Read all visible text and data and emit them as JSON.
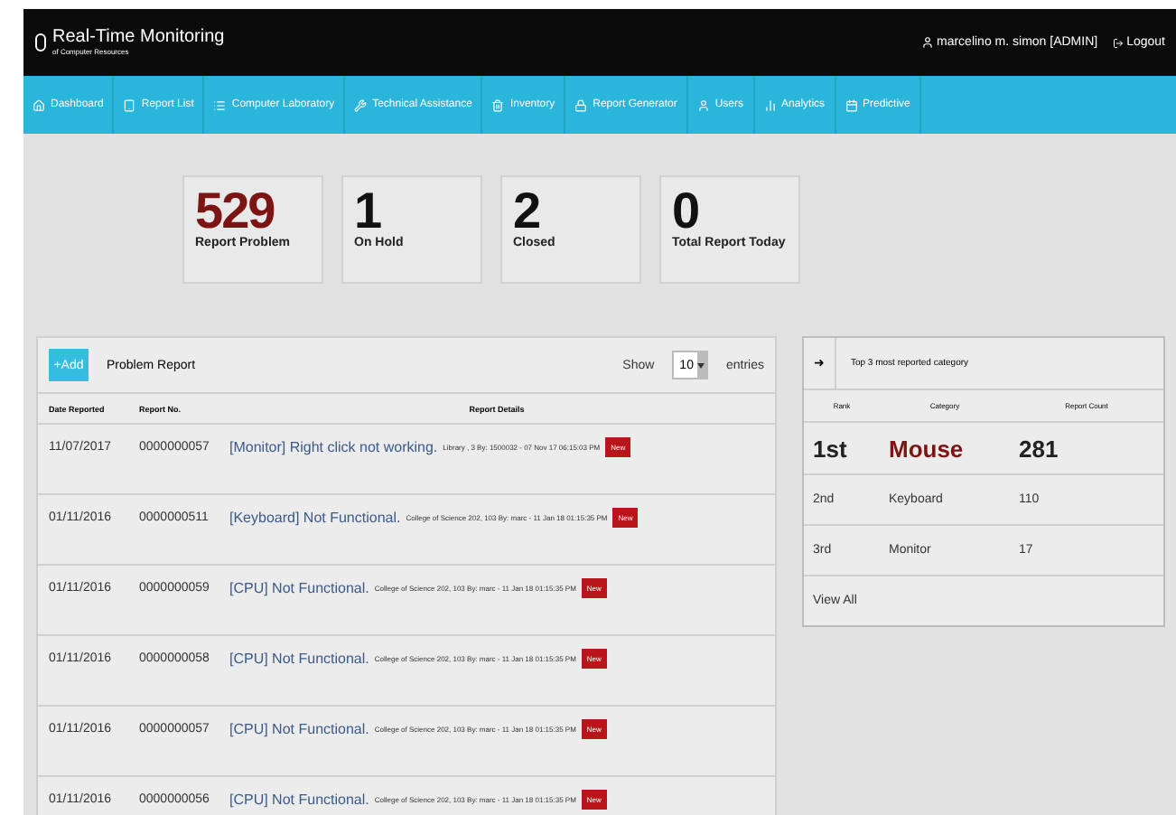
{
  "header": {
    "title": "Real-Time Monitoring",
    "subtitle": "of Computer Resources",
    "user": "marcelino m. simon [ADMIN]",
    "logout": "Logout"
  },
  "nav": [
    {
      "label": "Dashboard"
    },
    {
      "label": "Report List"
    },
    {
      "label": "Computer Laboratory"
    },
    {
      "label": "Technical Assistance"
    },
    {
      "label": "Inventory"
    },
    {
      "label": "Report Generator"
    },
    {
      "label": "Users"
    },
    {
      "label": "Analytics"
    },
    {
      "label": "Predictive"
    }
  ],
  "stats": [
    {
      "value": "529",
      "label": "Report Problem",
      "highlight": true
    },
    {
      "value": "1",
      "label": "On Hold",
      "highlight": false
    },
    {
      "value": "2",
      "label": "Closed",
      "highlight": false
    },
    {
      "value": "0",
      "label": "Total Report Today",
      "highlight": false
    }
  ],
  "report": {
    "add": "+Add",
    "title": "Problem Report",
    "show": "Show",
    "entries_value": "10",
    "entries": "entries",
    "columns": [
      "Date Reported",
      "Report No.",
      "Report Details"
    ],
    "rows": [
      {
        "date": "11/07/2017",
        "number": "0000000057",
        "title": "[Monitor] Right click not working.",
        "meta": "Library , 3 By: 1500032 - 07 Nov 17 06:15:03 PM",
        "badge": "New"
      },
      {
        "date": "01/11/2016",
        "number": "0000000511",
        "title": "[Keyboard] Not Functional.",
        "meta": "College of Science 202, 103 By: marc - 11 Jan 18 01:15:35 PM",
        "badge": "New"
      },
      {
        "date": "01/11/2016",
        "number": "0000000059",
        "title": "[CPU] Not Functional.",
        "meta": "College of Science 202, 103 By: marc - 11 Jan 18 01:15:35 PM",
        "badge": "New"
      },
      {
        "date": "01/11/2016",
        "number": "0000000058",
        "title": "[CPU] Not Functional.",
        "meta": "College of Science 202, 103 By: marc - 11 Jan 18 01:15:35 PM",
        "badge": "New"
      },
      {
        "date": "01/11/2016",
        "number": "0000000057",
        "title": "[CPU] Not Functional.",
        "meta": "College of Science 202, 103 By: marc - 11 Jan 18 01:15:35 PM",
        "badge": "New"
      },
      {
        "date": "01/11/2016",
        "number": "0000000056",
        "title": "[CPU] Not Functional.",
        "meta": "College of Science 202, 103 By: marc - 11 Jan 18 01:15:35 PM",
        "badge": "New"
      }
    ]
  },
  "top": {
    "arrow": "➜",
    "title": "Top 3 most reported category",
    "columns": [
      "Rank",
      "Category",
      "Report Count"
    ],
    "rows": [
      {
        "rank": "1st",
        "category": "Mouse",
        "count": "281",
        "highlight": true
      },
      {
        "rank": "2nd",
        "category": "Keyboard",
        "count": "110",
        "highlight": false
      },
      {
        "rank": "3rd",
        "category": "Monitor",
        "count": "17",
        "highlight": false
      }
    ],
    "view_all": "View All"
  }
}
